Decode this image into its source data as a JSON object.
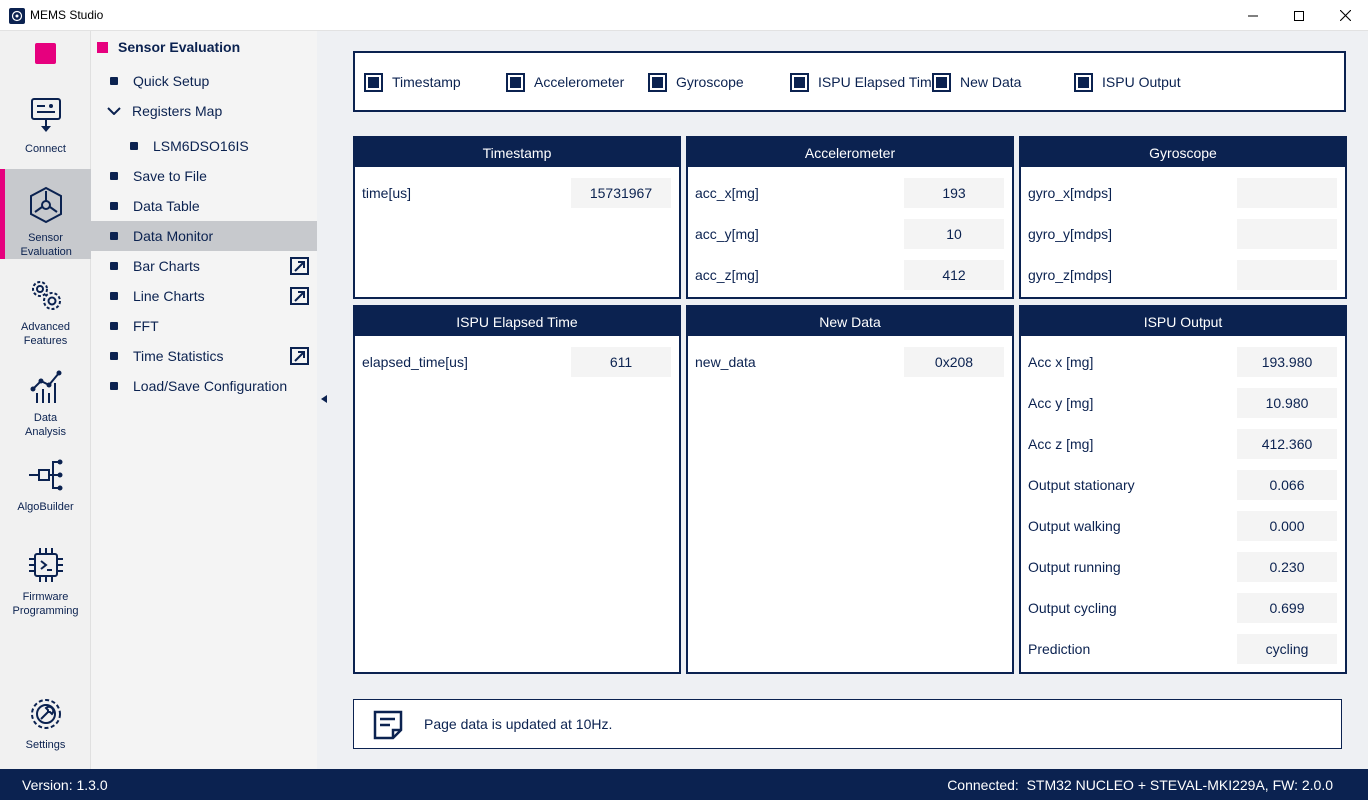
{
  "window": {
    "title": "MEMS Studio"
  },
  "rail": {
    "items": [
      {
        "label": "Connect",
        "icon": "connect-icon"
      },
      {
        "label": "Sensor Evaluation",
        "icon": "sensor-evaluation-icon",
        "active": true
      },
      {
        "label": "Advanced Features",
        "icon": "gears-icon"
      },
      {
        "label": "Data Analysis",
        "icon": "data-analysis-icon"
      },
      {
        "label": "AlgoBuilder",
        "icon": "algobuilder-icon"
      },
      {
        "label": "Firmware Programming",
        "icon": "chip-icon"
      },
      {
        "label": "Settings",
        "icon": "settings-icon"
      }
    ]
  },
  "menu": {
    "header": "Sensor Evaluation",
    "items": [
      {
        "label": "Quick Setup"
      },
      {
        "label": "Registers Map",
        "expanded": true
      },
      {
        "label": "LSM6DSO16IS",
        "sub": true
      },
      {
        "label": "Save to File"
      },
      {
        "label": "Data Table"
      },
      {
        "label": "Data Monitor",
        "active": true
      },
      {
        "label": "Bar Charts",
        "external": true
      },
      {
        "label": "Line Charts",
        "external": true
      },
      {
        "label": "FFT"
      },
      {
        "label": "Time Statistics",
        "external": true
      },
      {
        "label": "Load/Save Configuration"
      }
    ]
  },
  "filters": [
    {
      "label": "Timestamp",
      "checked": true
    },
    {
      "label": "Accelerometer",
      "checked": true
    },
    {
      "label": "Gyroscope",
      "checked": true
    },
    {
      "label": "ISPU Elapsed Time",
      "checked": true
    },
    {
      "label": "New Data",
      "checked": true
    },
    {
      "label": "ISPU Output",
      "checked": true
    }
  ],
  "cards": {
    "timestamp": {
      "title": "Timestamp",
      "rows": [
        {
          "label": "time[us]",
          "value": "15731967"
        }
      ]
    },
    "accelerometer": {
      "title": "Accelerometer",
      "rows": [
        {
          "label": "acc_x[mg]",
          "value": "193"
        },
        {
          "label": "acc_y[mg]",
          "value": "10"
        },
        {
          "label": "acc_z[mg]",
          "value": "412"
        }
      ]
    },
    "gyroscope": {
      "title": "Gyroscope",
      "rows": [
        {
          "label": "gyro_x[mdps]",
          "value": ""
        },
        {
          "label": "gyro_y[mdps]",
          "value": ""
        },
        {
          "label": "gyro_z[mdps]",
          "value": ""
        }
      ]
    },
    "ispu_elapsed": {
      "title": "ISPU Elapsed Time",
      "rows": [
        {
          "label": "elapsed_time[us]",
          "value": "611"
        }
      ]
    },
    "new_data": {
      "title": "New Data",
      "rows": [
        {
          "label": "new_data",
          "value": "0x208"
        }
      ]
    },
    "ispu_output": {
      "title": "ISPU Output",
      "rows": [
        {
          "label": "Acc x [mg]",
          "value": "193.980"
        },
        {
          "label": "Acc y [mg]",
          "value": "10.980"
        },
        {
          "label": "Acc z [mg]",
          "value": "412.360"
        },
        {
          "label": "Output stationary",
          "value": "0.066"
        },
        {
          "label": "Output walking",
          "value": "0.000"
        },
        {
          "label": "Output running",
          "value": "0.230"
        },
        {
          "label": "Output cycling",
          "value": "0.699"
        },
        {
          "label": "Prediction",
          "value": "cycling"
        }
      ]
    }
  },
  "info": {
    "text": "Page data is updated at 10Hz."
  },
  "status": {
    "version": "Version: 1.3.0",
    "connected": "Connected:  STM32 NUCLEO + STEVAL-MKI229A, FW: 2.0.0"
  },
  "colors": {
    "primary": "#0b2250",
    "accent": "#e6007e",
    "rail_bg": "#f1f1f1",
    "content_bg": "#eef0f3"
  }
}
